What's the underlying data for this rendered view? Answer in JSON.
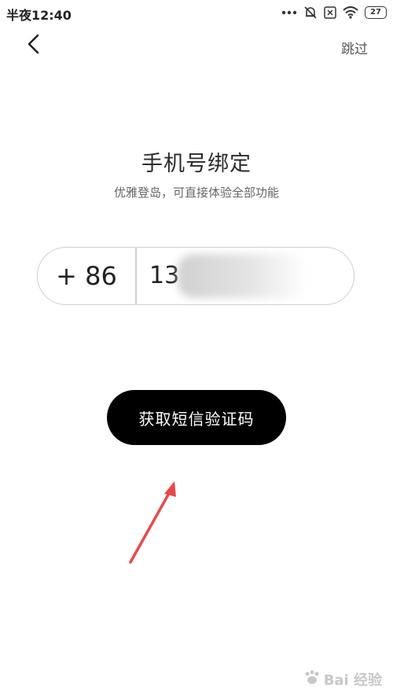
{
  "status_bar": {
    "time": "半夜12:40",
    "icons": [
      "more-dots-icon",
      "mute-bell-icon",
      "sim-x-icon",
      "wifi-icon"
    ],
    "battery": "27"
  },
  "nav": {
    "back_icon": "chevron-left-icon",
    "skip": "跳过"
  },
  "header": {
    "title": "手机号绑定",
    "subtitle": "优雅登岛，可直接体验全部功能"
  },
  "phone": {
    "country_code": "+ 86",
    "value": "13"
  },
  "actions": {
    "get_code": "获取短信验证码"
  },
  "annotation": {
    "color": "#e8484b"
  },
  "watermark": {
    "text": "Bai 经验"
  }
}
